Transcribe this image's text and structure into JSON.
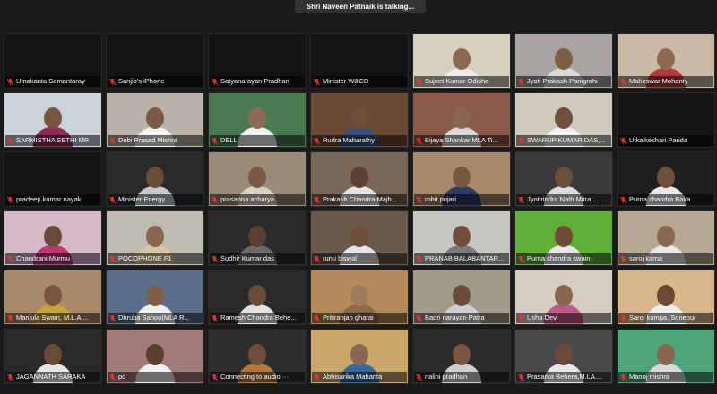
{
  "banner": {
    "text": "Shri Naveen Patnaik is talking..."
  },
  "participants": [
    {
      "name": "Umakanta Samantaray",
      "video": false
    },
    {
      "name": "Sanjib's iPhone",
      "video": false
    },
    {
      "name": "Satyanarayan Pradhan",
      "video": false
    },
    {
      "name": "Minister W&CD",
      "video": false
    },
    {
      "name": "Sujeet Kumar Odisha",
      "video": true,
      "bg": "#d6d0bf",
      "skin": "#8a6a52",
      "shirt": "#e9e9e9"
    },
    {
      "name": "Jyoti Prakash Panigrahi",
      "video": true,
      "bg": "#a9a4a0",
      "skin": "#7e5d47",
      "shirt": "#d8d8d8"
    },
    {
      "name": "Maheswar Mohanty",
      "video": true,
      "bg": "#c9b9a6",
      "skin": "#8f6a53",
      "shirt": "#b33a3a"
    },
    {
      "name": "SARMISTHA SETHI MP",
      "video": true,
      "bg": "#cdd3da",
      "skin": "#7a5642",
      "shirt": "#8e2b55"
    },
    {
      "name": "Debi Prasad Mishra",
      "video": true,
      "bg": "#b9b2a8",
      "skin": "#7d5a45",
      "shirt": "#f1f1f1"
    },
    {
      "name": "DELL",
      "video": true,
      "bg": "#4a7a52",
      "skin": "#8c6a55",
      "shirt": "#efefef"
    },
    {
      "name": "Rudra Maharathy",
      "video": true,
      "bg": "#6a4a35",
      "skin": "#6e4d3b",
      "shirt": "#3d4f7a"
    },
    {
      "name": "Bijaya Shankar MLA Ti...",
      "video": true,
      "bg": "#8a5a4a",
      "skin": "#8a6650",
      "shirt": "#d7d7d7"
    },
    {
      "name": "SWARUP KUMAR DAS,...",
      "video": true,
      "bg": "#cfc9bd",
      "skin": "#6f4f3d",
      "shirt": "#efefef"
    },
    {
      "name": "Utkalkeshari Parida",
      "video": false
    },
    {
      "name": "pradeep kumar nayak",
      "video": false
    },
    {
      "name": "Minister Energy",
      "video": true,
      "bg": "#2a2a2a",
      "skin": "#6a4c3a",
      "shirt": "#c9c9c9"
    },
    {
      "name": "prasanna acharya",
      "video": true,
      "bg": "#9a8a78",
      "skin": "#7b5a45",
      "shirt": "#d9d2c4"
    },
    {
      "name": "Prakash Chandra Majh...",
      "video": true,
      "bg": "#7a6656",
      "skin": "#5e4231",
      "shirt": "#e3e3e3"
    },
    {
      "name": "rohit pujari",
      "video": true,
      "bg": "#a68a6a",
      "skin": "#7a573f",
      "shirt": "#2f3a66"
    },
    {
      "name": "Jyotirindra Nath Mitra ...",
      "video": true,
      "bg": "#3a3a3a",
      "skin": "#6c4e3c",
      "shirt": "#dcdcdc"
    },
    {
      "name": "Purna chandra Baka",
      "video": true,
      "bg": "#1f1f1f",
      "skin": "#6d4f3c",
      "shirt": "#e8e8e8"
    },
    {
      "name": "Chandrani Murmu",
      "video": true,
      "bg": "#d4b9c9",
      "skin": "#6c4a38",
      "shirt": "#b83a6f"
    },
    {
      "name": "POCOPHONE F1",
      "video": true,
      "bg": "#bfbab2",
      "skin": "#8a6651",
      "shirt": "#d9c6a0"
    },
    {
      "name": "Sudhir Kumar das",
      "video": true,
      "bg": "#2b2b2b",
      "skin": "#5a4030",
      "shirt": "#6a6a6a"
    },
    {
      "name": "runu biswal",
      "video": true,
      "bg": "#6a5a4e",
      "skin": "#6e4f3c",
      "shirt": "#e4e4e4"
    },
    {
      "name": "PRANAB BALABANTAR...",
      "video": true,
      "bg": "#c8c6c2",
      "skin": "#6f4d39",
      "shirt": "#7a7a7a"
    },
    {
      "name": "Purna chandra swain",
      "video": true,
      "bg": "#5fae3a",
      "skin": "#6e4d38",
      "shirt": "#e7e7e7"
    },
    {
      "name": "saroj karna",
      "video": true,
      "bg": "#b6a892",
      "skin": "#8a6752",
      "shirt": "#e8e8e8"
    },
    {
      "name": "Manjula Swain, M.L.A....",
      "video": true,
      "bg": "#a88a6a",
      "skin": "#7a5540",
      "shirt": "#c9a33a"
    },
    {
      "name": "Dhruba Sahoo(MLA R...",
      "video": true,
      "bg": "#5a6e8a",
      "skin": "#7f5c46",
      "shirt": "#f1f1f1"
    },
    {
      "name": "Ramesh Chandra Behe...",
      "video": true,
      "bg": "#2a2a2a",
      "skin": "#6a4b38",
      "shirt": "#e2e2e2"
    },
    {
      "name": "Pritiranjan gharai",
      "video": true,
      "bg": "#b48a5a",
      "skin": "#a07c5a",
      "shirt": "#8a6a4a"
    },
    {
      "name": "Badri narayan Patra",
      "video": true,
      "bg": "#a39a8a",
      "skin": "#6d4d3a",
      "shirt": "#cfcfcf"
    },
    {
      "name": "Usha Devi",
      "video": true,
      "bg": "#d6ccc0",
      "skin": "#8a6652",
      "shirt": "#c05a8a"
    },
    {
      "name": "Saroj kampa, Soneour",
      "video": true,
      "bg": "#d8b88a",
      "skin": "#6b4a36",
      "shirt": "#f0f0f0"
    },
    {
      "name": "JAGANNATH SARAKA",
      "video": true,
      "bg": "#2a2a2a",
      "skin": "#6a4b38",
      "shirt": "#e6e6e6"
    },
    {
      "name": "pc",
      "video": true,
      "bg": "#a27a7a",
      "skin": "#5a3e2e",
      "shirt": "#f0f0f0"
    },
    {
      "name": "Connecting to audio ···",
      "video": true,
      "bg": "#2e2e2e",
      "skin": "#6e4e3b",
      "shirt": "#b07a3a"
    },
    {
      "name": "Abhisarika Mahanta",
      "video": true,
      "bg": "#c9a66a",
      "skin": "#8a6652",
      "shirt": "#3a6a9a"
    },
    {
      "name": "nalini pradhan",
      "video": true,
      "bg": "#2b2b2b",
      "skin": "#7a5540",
      "shirt": "#cfcfcf"
    },
    {
      "name": "Prasanta Behera,M.LA....",
      "video": true,
      "bg": "#4a4a4a",
      "skin": "#6a4a38",
      "shirt": "#e7e7e7"
    },
    {
      "name": "Manoj mishra",
      "video": true,
      "bg": "#4fa67a",
      "skin": "#8a6652",
      "shirt": "#d9d9d9"
    }
  ],
  "colors": {
    "mute": "#e53935",
    "banner_bg": "#333333",
    "grid_bg": "#1a1a1a"
  },
  "icons": {
    "mute": "muted-microphone-icon"
  }
}
